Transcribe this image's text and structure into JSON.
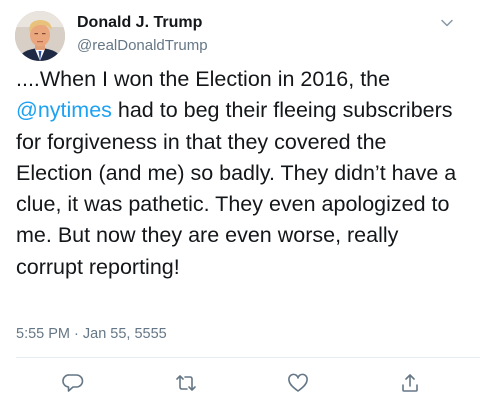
{
  "author": {
    "display_name": "Donald J. Trump",
    "handle": "@realDonaldTrump",
    "avatar_icon": "profile-photo"
  },
  "tweet": {
    "text_before_mention": "....When I won the Election in 2016, the ",
    "mention": "@nytimes",
    "text_after_mention": " had to beg their fleeing subscribers for forgiveness in that they covered the Election (and me) so badly. They didn’t have a clue, it was pathetic. They even apologized to me. But now they are even worse, really corrupt reporting!",
    "timestamp": "5:55 PM · Jan 55, 5555"
  },
  "actions": [
    {
      "name": "reply",
      "icon": "reply-icon"
    },
    {
      "name": "retweet",
      "icon": "retweet-icon"
    },
    {
      "name": "like",
      "icon": "heart-icon"
    },
    {
      "name": "share",
      "icon": "share-icon"
    }
  ],
  "colors": {
    "link": "#1da1f2",
    "secondary_text": "#657786",
    "icon": "#657786",
    "divider": "#e6ecf0"
  }
}
